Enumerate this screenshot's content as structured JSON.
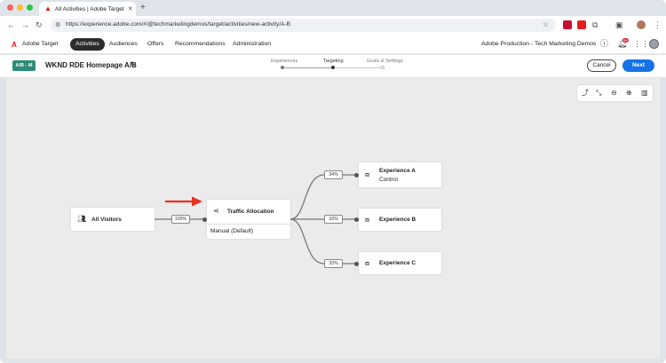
{
  "browser": {
    "tab_title": "All Activities | Adobe Target",
    "url": "https://experience.adobe.com/#/@techmarketingdemos/target/activities/new-activity/A-B"
  },
  "app": {
    "brand": "Adobe Target",
    "nav": [
      "Activities",
      "Audiences",
      "Offers",
      "Recommendations",
      "Administration"
    ],
    "active_nav": "Activities",
    "org": "Adobe Production - Tech Marketing Demos",
    "notification_count": "9+"
  },
  "activity": {
    "type_badge": "A/B - M",
    "name": "WKND RDE Homepage A/B",
    "steps": [
      "Experiences",
      "Targeting",
      "Goals & Settings"
    ],
    "current_step": "Targeting",
    "cancel_label": "Cancel",
    "next_label": "Next"
  },
  "flow": {
    "audience": "All Visitors",
    "audience_pct": "100%",
    "allocation_title": "Traffic Allocation",
    "allocation_method": "Manual (Default)",
    "experiences": [
      {
        "name": "Experience A",
        "sub": "Control",
        "pct": "34%"
      },
      {
        "name": "Experience B",
        "sub": "",
        "pct": "33%"
      },
      {
        "name": "Experience C",
        "sub": "",
        "pct": "33%"
      }
    ]
  },
  "colors": {
    "accent": "#1473e6",
    "badge": "#2d8c77",
    "brand_red": "#eb1000",
    "arrow": "#e8311f"
  },
  "icons": {
    "audience": "people-icon",
    "allocation": "share-icon",
    "experience": "experience-icon"
  }
}
